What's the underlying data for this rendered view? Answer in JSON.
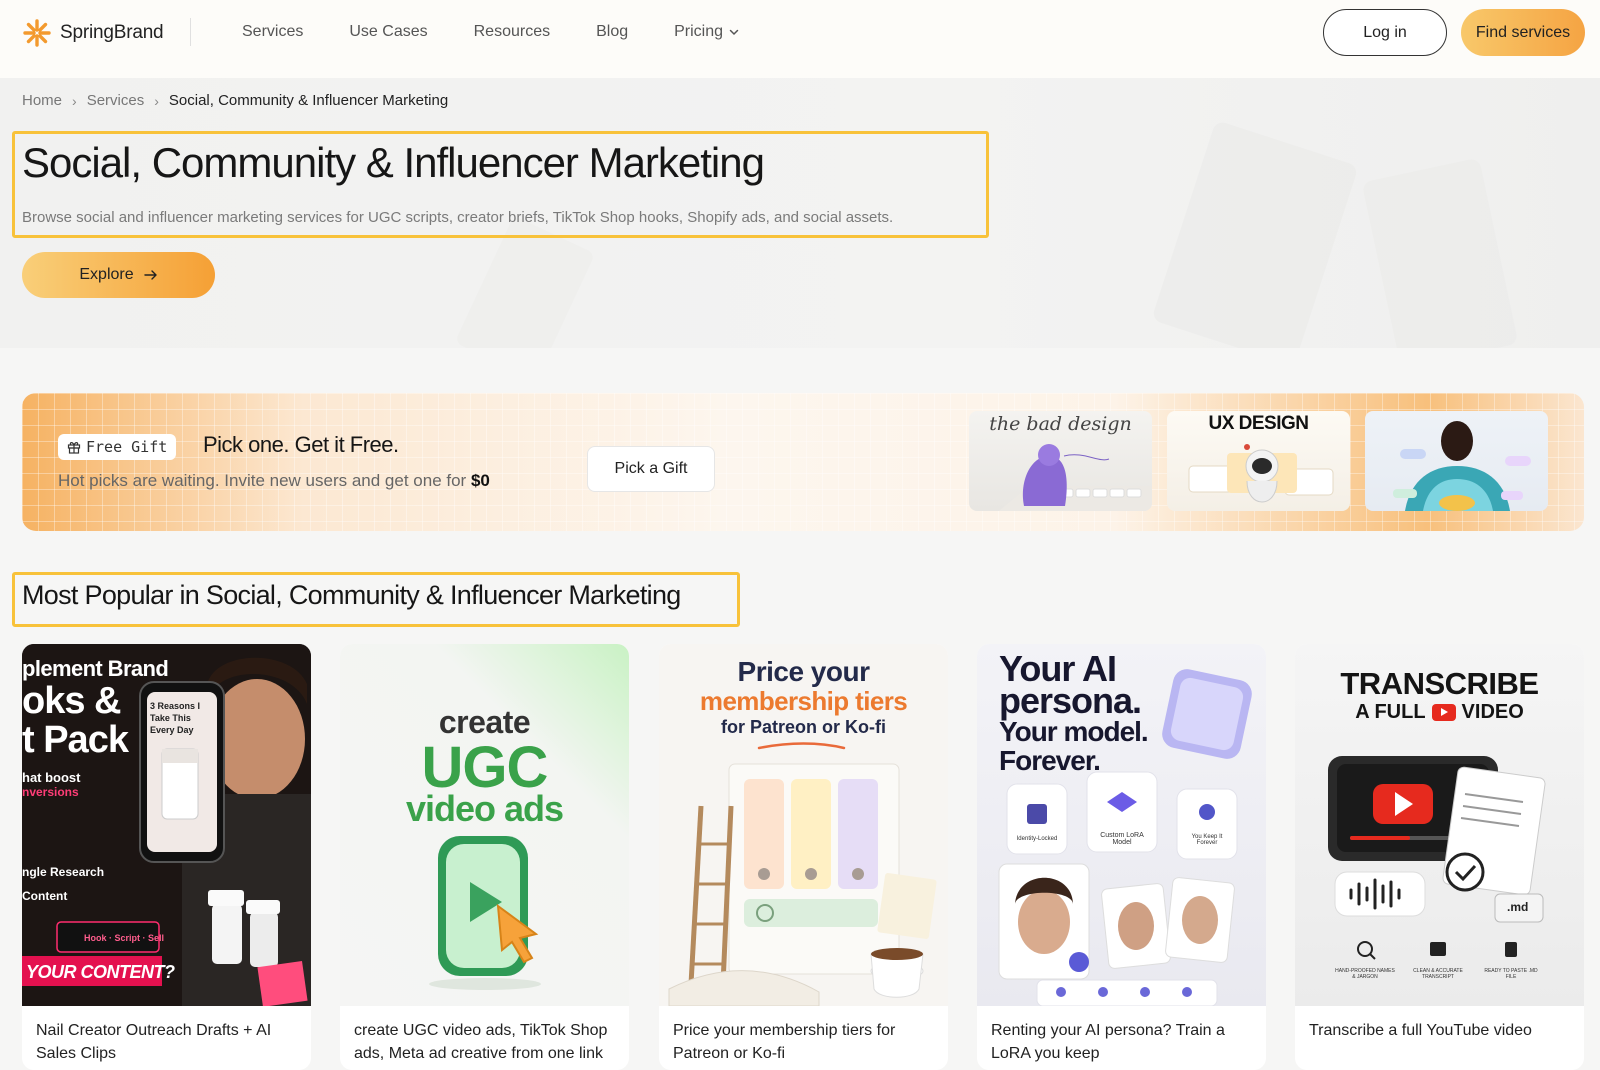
{
  "header": {
    "brand": "SpringBrand",
    "nav": [
      {
        "label": "Services"
      },
      {
        "label": "Use Cases"
      },
      {
        "label": "Resources"
      },
      {
        "label": "Blog"
      },
      {
        "label": "Pricing"
      }
    ],
    "login_label": "Log in",
    "find_label": "Find services",
    "accent_color": "#f5a443"
  },
  "breadcrumb": {
    "items": [
      "Home",
      "Services"
    ],
    "current": "Social, Community & Influencer Marketing"
  },
  "hero": {
    "title": "Social, Community & Influencer Marketing",
    "subtitle": "Browse social and influencer marketing services for UGC scripts, creator briefs, TikTok Shop hooks, Shopify ads, and social assets.",
    "cta": "Explore"
  },
  "gift": {
    "badge": "Free Gift",
    "title": "Pick one. Get it Free.",
    "subtitle": "Hot picks are waiting. Invite new users and get one for",
    "price": "$0",
    "button": "Pick a Gift",
    "thumbnails": [
      {
        "label": "the bad design",
        "icon": "purple-figure"
      },
      {
        "label": "UX DESIGN",
        "icon": "astronaut"
      },
      {
        "label": "",
        "icon": "person-portrait"
      }
    ]
  },
  "section": {
    "title": "Most Popular in Social, Community & Influencer Marketing"
  },
  "cards": [
    {
      "caption": "Nail Creator Outreach Drafts + AI Sales Clips",
      "img_text": {
        "l1": "plement Brand",
        "l2": "oks &",
        "l3": "t Pack",
        "l4": "hat boost",
        "l5": "nversions",
        "l6": "ngle Research",
        "l7": "Content",
        "l8": "YOUR CONTENT?",
        "phone": "3 Reasons I Take This Every Day",
        "chip": "Hook · Script · Sell"
      }
    },
    {
      "caption": "create UGC video ads, TikTok Shop ads, Meta ad creative from one link",
      "img_text": {
        "l1": "create",
        "l2": "UGC",
        "l3": "video ads"
      }
    },
    {
      "caption": "Price your membership tiers for Patreon or Ko-fi",
      "img_text": {
        "l1": "Price your",
        "l2": "membership tiers",
        "l3": "for Patreon or Ko-fi"
      }
    },
    {
      "caption": "Renting your AI persona? Train a LoRA you keep",
      "img_text": {
        "l1": "Your AI",
        "l2": "persona.",
        "l3": "Your model.",
        "l4": "Forever.",
        "b1": "Identity-Locked",
        "b2": "Custom LoRA Model",
        "b3": "You Keep It Forever"
      }
    },
    {
      "caption": "Transcribe a full YouTube video",
      "img_text": {
        "l1": "TRANSCRIBE",
        "l2": "A FULL",
        "l3": "VIDEO",
        "md": ".md",
        "f1": "HAND-PROOFED NAMES & JARGON",
        "f2": "CLEAN & ACCURATE TRANSCRIPT",
        "f3": "READY TO PASTE .MD FILE"
      }
    }
  ]
}
